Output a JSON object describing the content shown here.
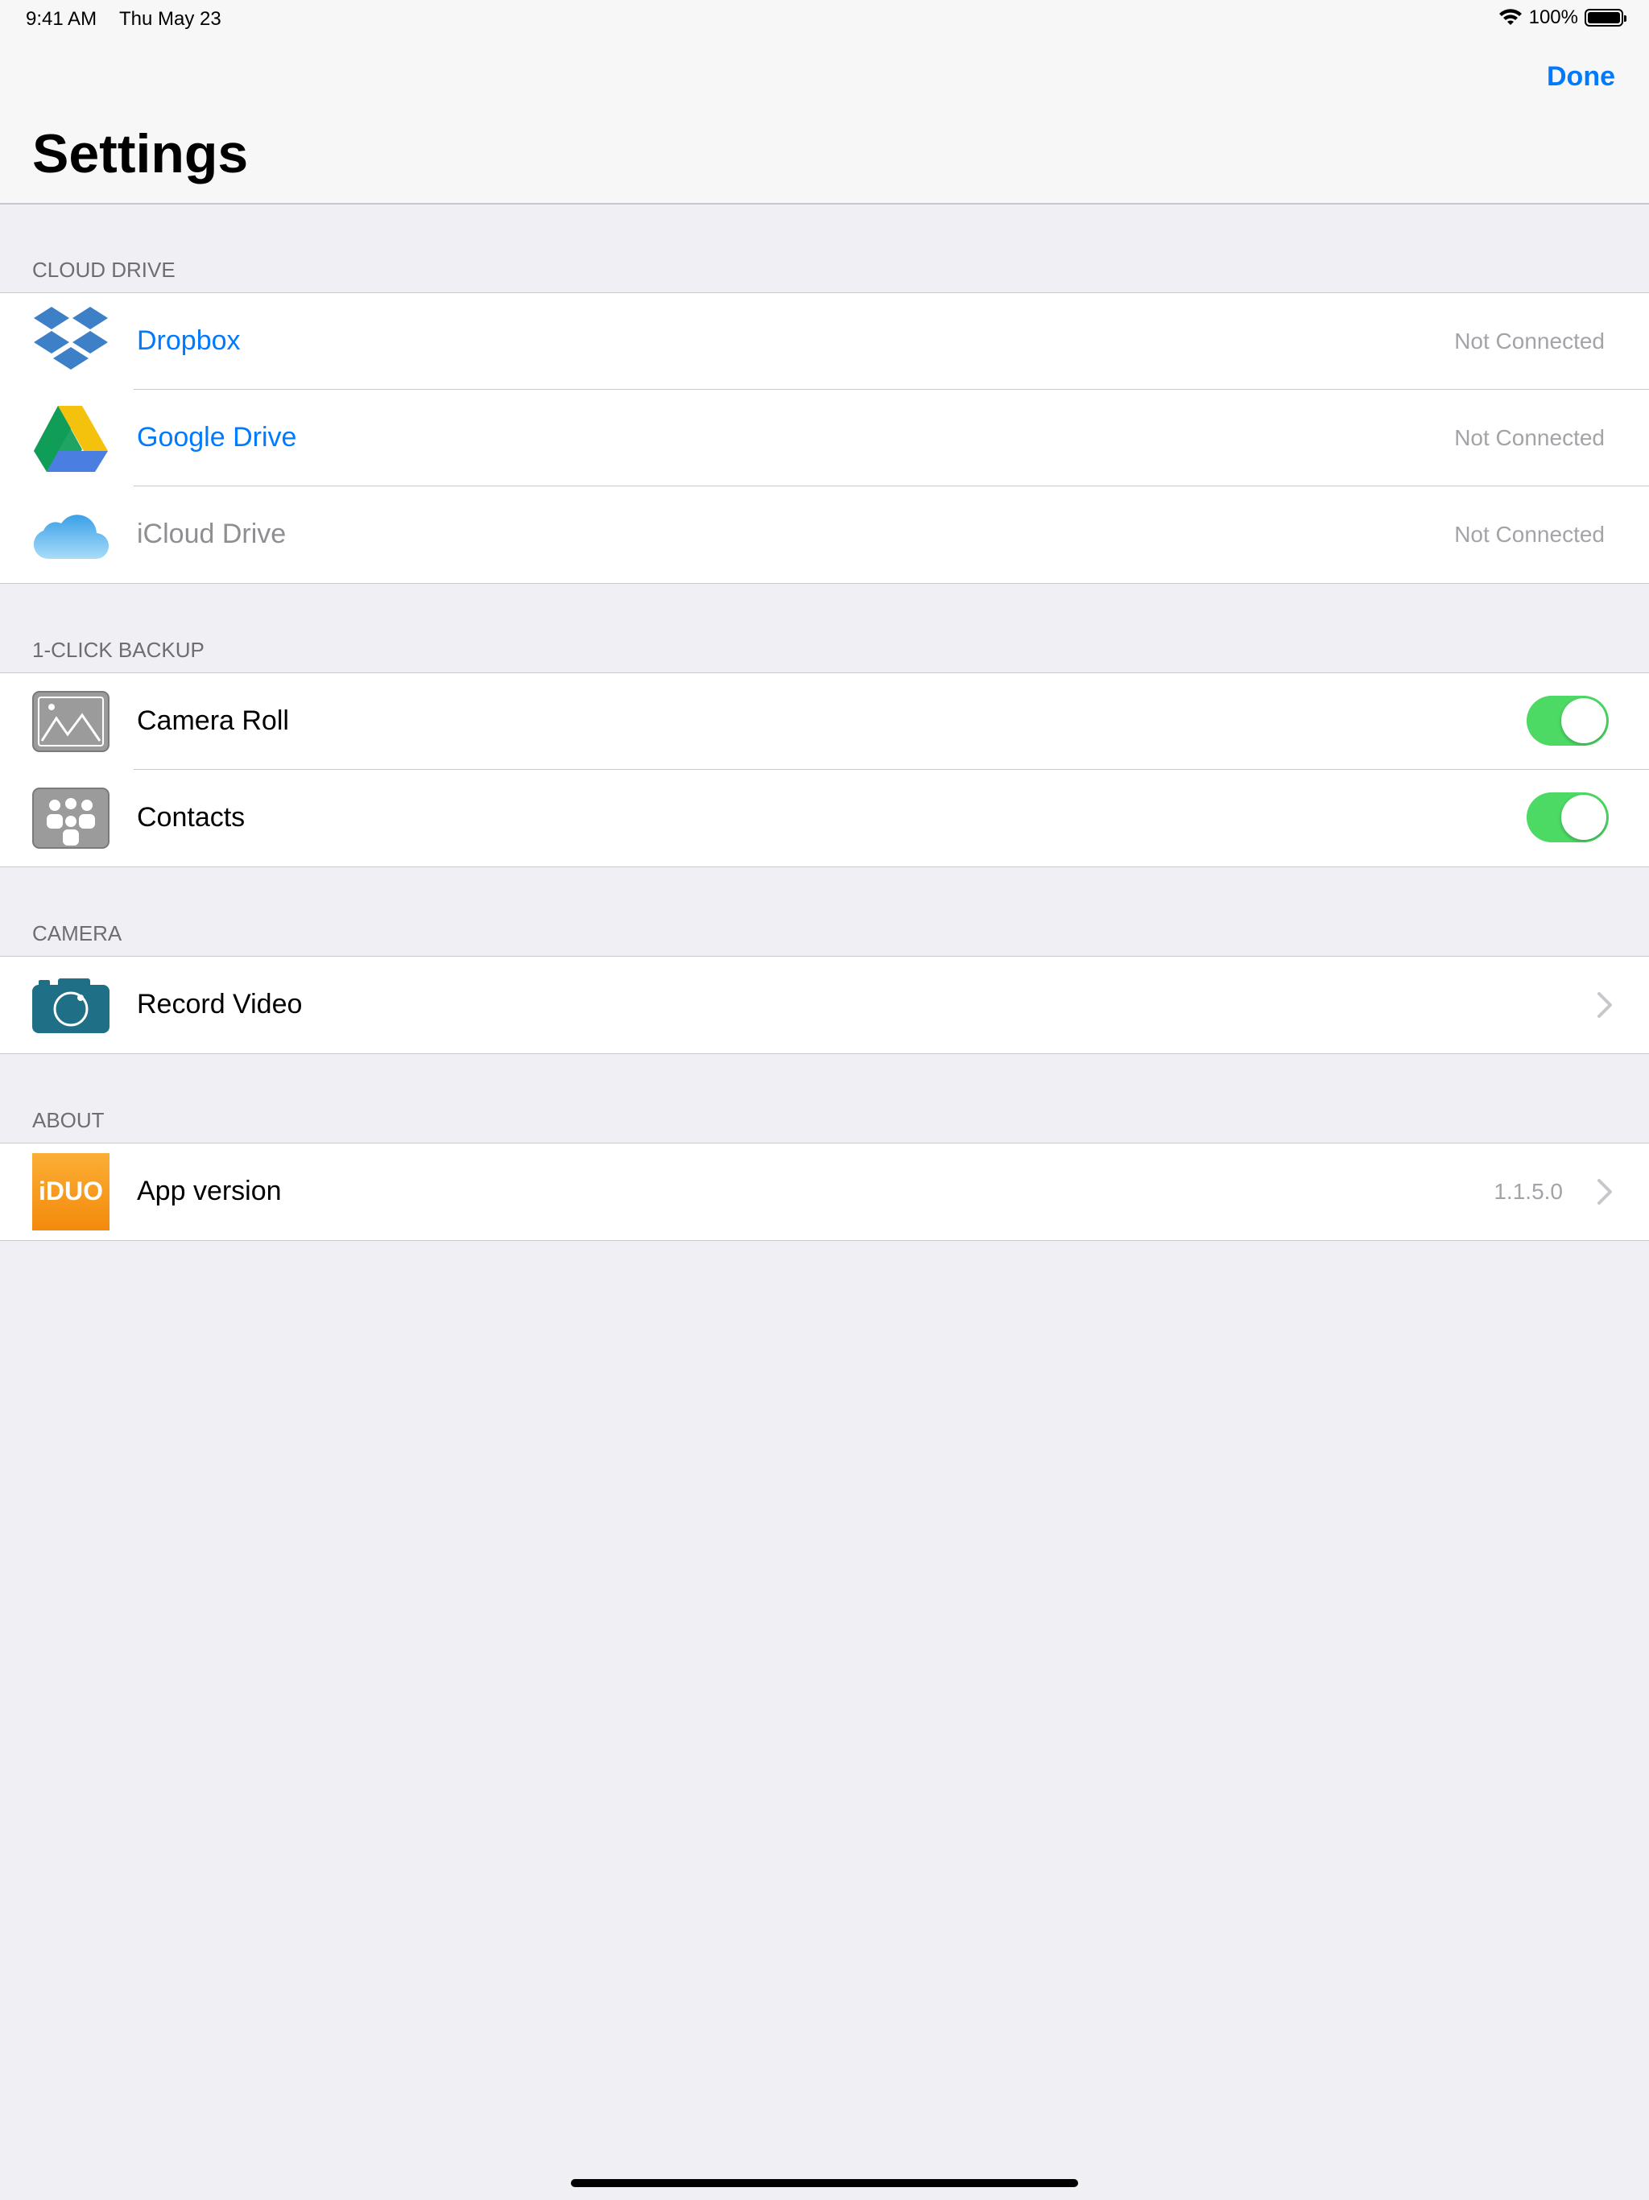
{
  "status_bar": {
    "time": "9:41 AM",
    "date": "Thu May 23",
    "battery_percent": "100%",
    "battery_level": 1.0
  },
  "nav": {
    "done_label": "Done",
    "title": "Settings"
  },
  "sections": {
    "cloud_drive": {
      "header": "CLOUD DRIVE",
      "items": [
        {
          "label": "Dropbox",
          "detail": "Not Connected",
          "icon": "dropbox-icon"
        },
        {
          "label": "Google Drive",
          "detail": "Not Connected",
          "icon": "google-drive-icon"
        },
        {
          "label": "iCloud Drive",
          "detail": "Not Connected",
          "icon": "icloud-icon"
        }
      ]
    },
    "backup": {
      "header": "1-CLICK BACKUP",
      "items": [
        {
          "label": "Camera Roll",
          "toggle_on": true,
          "icon": "photos-icon"
        },
        {
          "label": "Contacts",
          "toggle_on": true,
          "icon": "contacts-icon"
        }
      ]
    },
    "camera": {
      "header": "CAMERA",
      "items": [
        {
          "label": "Record Video",
          "icon": "camera-icon"
        }
      ]
    },
    "about": {
      "header": "ABOUT",
      "items": [
        {
          "label": "App version",
          "detail": "1.1.5.0",
          "icon": "app-logo-icon",
          "logo_text": "iDUO"
        }
      ]
    }
  },
  "colors": {
    "accent": "#007aff",
    "toggle_on": "#4cd964",
    "background": "#efeff4",
    "app_logo": "#f7941d",
    "camera_icon": "#1f6f86"
  }
}
